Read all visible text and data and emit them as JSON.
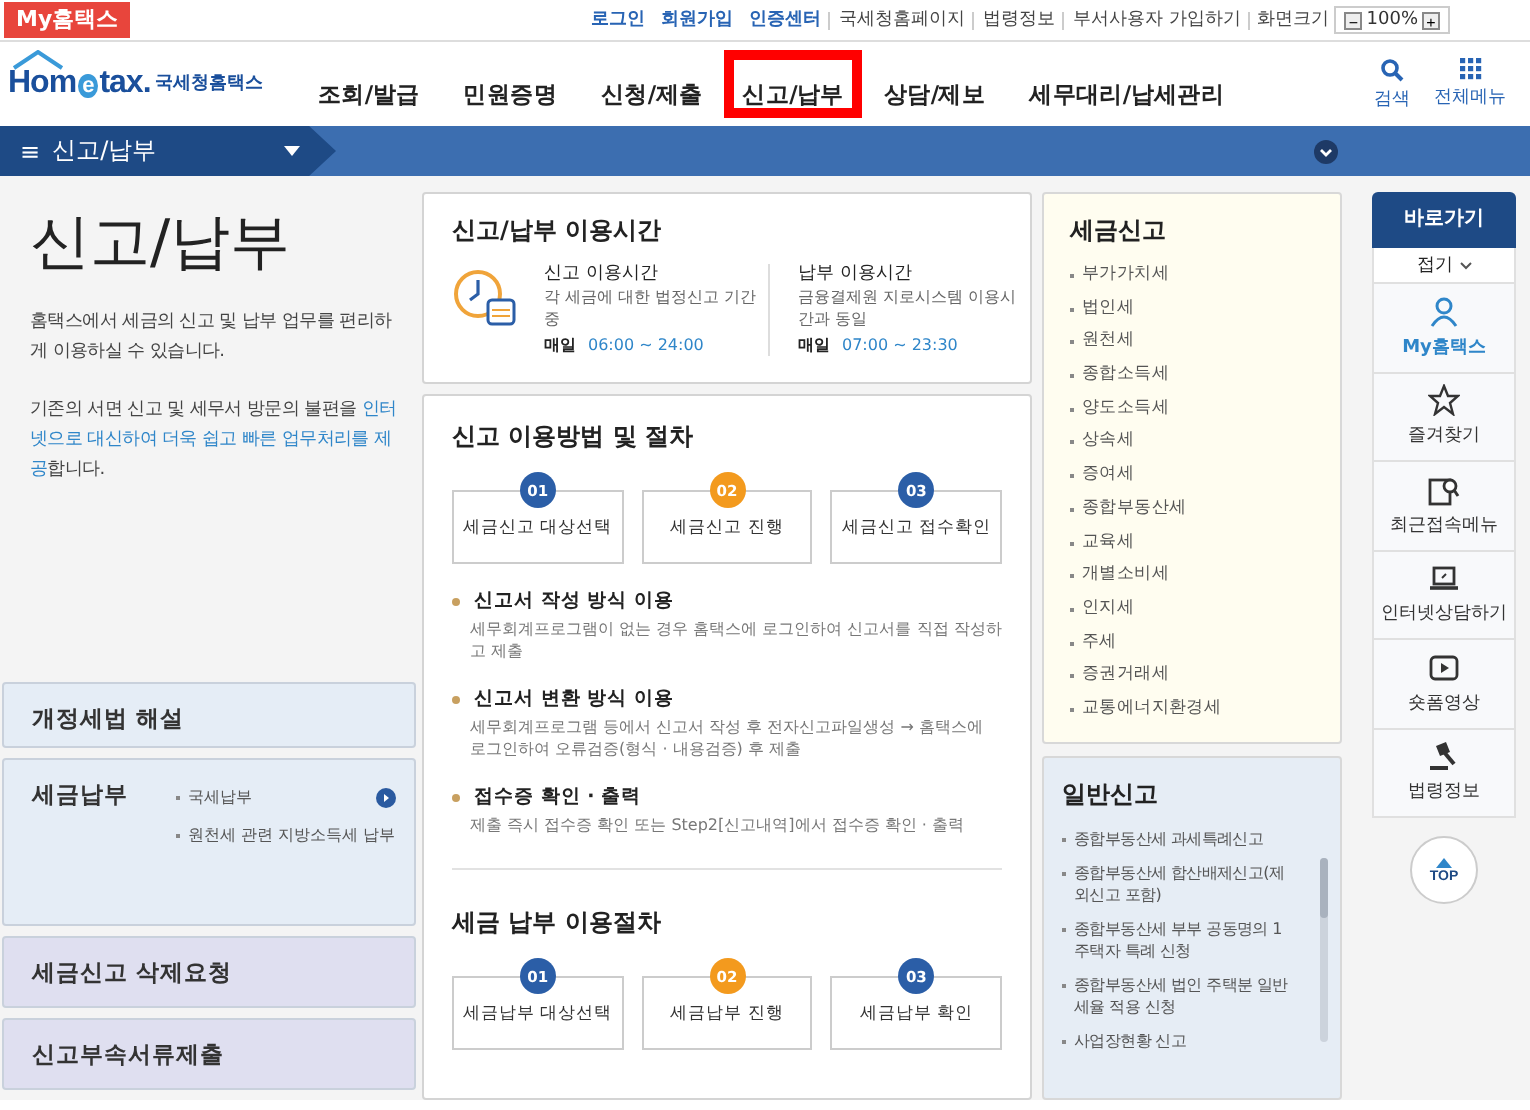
{
  "top_bar": {
    "my_button": "My홈택스",
    "links": [
      {
        "label": "로그인",
        "emphasis": true
      },
      {
        "label": "회원가입",
        "emphasis": true
      },
      {
        "label": "인증센터",
        "emphasis": true
      },
      {
        "label": "국세청홈페이지",
        "emphasis": false
      },
      {
        "label": "법령정보",
        "emphasis": false
      },
      {
        "label": "부서사용자 가입하기",
        "emphasis": false
      }
    ],
    "zoom_label": "화면크기",
    "zoom_out": "−",
    "zoom_value": "100%",
    "zoom_in": "+"
  },
  "header": {
    "logo": [
      "Hom",
      "e",
      "tax."
    ],
    "logo_subtitle": "국세청홈택스",
    "nav": [
      {
        "label": "조회/발급",
        "selected": false
      },
      {
        "label": "민원증명",
        "selected": false
      },
      {
        "label": "신청/제출",
        "selected": false
      },
      {
        "label": "신고/납부",
        "selected": true
      },
      {
        "label": "상담/제보",
        "selected": false
      },
      {
        "label": "세무대리/납세관리",
        "selected": false
      }
    ],
    "search": "검색",
    "all_menu": "전체메뉴"
  },
  "breadcrumb": {
    "menu_glyph": "≡",
    "title": "신고/납부"
  },
  "intro": {
    "title": "신고/납부",
    "para1": "홈택스에서 세금의 신고 및 납부 업무를 편리하게 이용하실 수 있습니다.",
    "para2": [
      {
        "text": "기존의 서면 신고 및 세무서 방문의 불편을 ",
        "highlight": false
      },
      {
        "text": "인터넷으로 대신하여 더욱 쉽고 빠른 업무처리를 제공",
        "highlight": true
      },
      {
        "text": "합니다.",
        "highlight": false
      }
    ]
  },
  "side_cards": [
    {
      "title": "개정세법 해설",
      "color": "#e5edf6"
    },
    {
      "title": "세금납부",
      "color": "#e5edf6",
      "links": [
        "국세납부",
        "원천세 관련 지방소득세 납부"
      ]
    },
    {
      "title": "세금신고 삭제요청",
      "color": "#dfdff0"
    },
    {
      "title": "신고부속서류제출",
      "color": "#dfdff0"
    }
  ],
  "hours": {
    "title": "신고/납부 이용시간",
    "blocks": [
      {
        "title": "신고 이용시간",
        "desc": "각 세금에 대한 법정신고 기간 중",
        "label": "매일",
        "time": "06:00 ~ 24:00"
      },
      {
        "title": "납부 이용시간",
        "desc": "금융결제원 지로시스템 이용시간과 동일",
        "label": "매일",
        "time": "07:00 ~ 23:30"
      }
    ]
  },
  "report_procedure": {
    "title": "신고 이용방법 및 절차",
    "steps": [
      {
        "number": "01",
        "label": "세금신고 대상선택",
        "current": false
      },
      {
        "number": "02",
        "label": "세금신고 진행",
        "current": true
      },
      {
        "number": "03",
        "label": "세금신고 접수확인",
        "current": false
      }
    ],
    "methods": [
      {
        "title": "신고서 작성 방식 이용",
        "desc": "세무회계프로그램이 없는 경우 홈택스에 로그인하여 신고서를 직접 작성하고 제출"
      },
      {
        "title": "신고서 변환 방식 이용",
        "desc": "세무회계프로그램 등에서 신고서 작성 후 전자신고파일생성 → 홈택스에 로그인하여 오류검증(형식 · 내용검증) 후 제출"
      },
      {
        "title": "접수증 확인 · 출력",
        "desc": "제출 즉시 접수증 확인 또는 Step2[신고내역]에서 접수증 확인 · 출력"
      }
    ]
  },
  "payment_procedure": {
    "title": "세금 납부 이용절차",
    "steps": [
      {
        "number": "01",
        "label": "세금납부 대상선택",
        "current": false
      },
      {
        "number": "02",
        "label": "세금납부 진행",
        "current": true
      },
      {
        "number": "03",
        "label": "세금납부 확인",
        "current": false
      }
    ]
  },
  "tax_report": {
    "title": "세금신고",
    "items": [
      "부가가치세",
      "법인세",
      "원천세",
      "종합소득세",
      "양도소득세",
      "상속세",
      "증여세",
      "종합부동산세",
      "교육세",
      "개별소비세",
      "인지세",
      "주세",
      "증권거래세",
      "교통에너지환경세"
    ]
  },
  "general_report": {
    "title": "일반신고",
    "items": [
      "종합부동산세 과세특례신고",
      "종합부동산세 합산배제신고(제외신고 포함)",
      "종합부동산세 부부 공동명의 1주택자 특례 신청",
      "종합부동산세 법인 주택분 일반세율 적용 신청",
      "사업장현황 신고"
    ]
  },
  "quick_menu": {
    "title": "바로가기",
    "fold": "접기",
    "items": [
      {
        "kind": "user",
        "label": "My홈택스",
        "selected": true
      },
      {
        "kind": "star",
        "label": "즐겨찾기",
        "selected": false
      },
      {
        "kind": "recent",
        "label": "최근접속메뉴",
        "selected": false
      },
      {
        "kind": "laptop",
        "label": "인터넷상담하기",
        "selected": false
      },
      {
        "kind": "video",
        "label": "숏폼영상",
        "selected": false
      },
      {
        "kind": "gavel",
        "label": "법령정보",
        "selected": false
      }
    ],
    "top": "TOP"
  }
}
